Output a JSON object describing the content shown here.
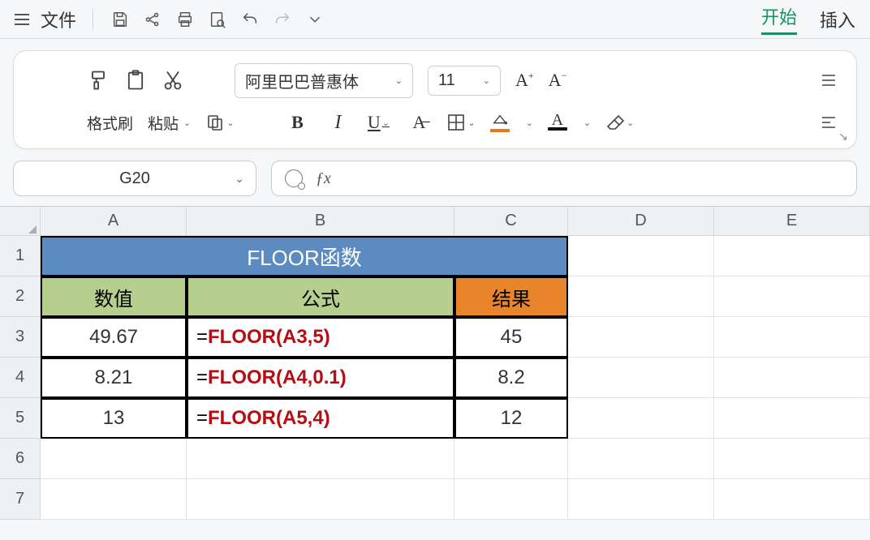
{
  "menubar": {
    "file": "文件",
    "start": "开始",
    "insert": "插入"
  },
  "ribbon": {
    "format_painter": "格式刷",
    "paste": "粘贴",
    "font_name": "阿里巴巴普惠体",
    "font_size": "11"
  },
  "namebox": "G20",
  "fx_label": "ƒx",
  "columns": [
    "A",
    "B",
    "C",
    "D",
    "E"
  ],
  "rows": [
    "1",
    "2",
    "3",
    "4",
    "5",
    "6",
    "7"
  ],
  "table": {
    "title": "FLOOR函数",
    "headers": {
      "value": "数值",
      "formula": "公式",
      "result": "结果"
    },
    "rows": [
      {
        "value": "49.67",
        "formula": "FLOOR(A3,5)",
        "result": "45"
      },
      {
        "value": "8.21",
        "formula": "FLOOR(A4,0.1)",
        "result": "8.2"
      },
      {
        "value": "13",
        "formula": "FLOOR(A5,4)",
        "result": "12"
      }
    ]
  },
  "chart_data": {
    "type": "table",
    "title": "FLOOR函数",
    "columns": [
      "数值",
      "公式",
      "结果"
    ],
    "rows": [
      [
        "49.67",
        "=FLOOR(A3,5)",
        "45"
      ],
      [
        "8.21",
        "=FLOOR(A4,0.1)",
        "8.2"
      ],
      [
        "13",
        "=FLOOR(A5,4)",
        "12"
      ]
    ]
  }
}
